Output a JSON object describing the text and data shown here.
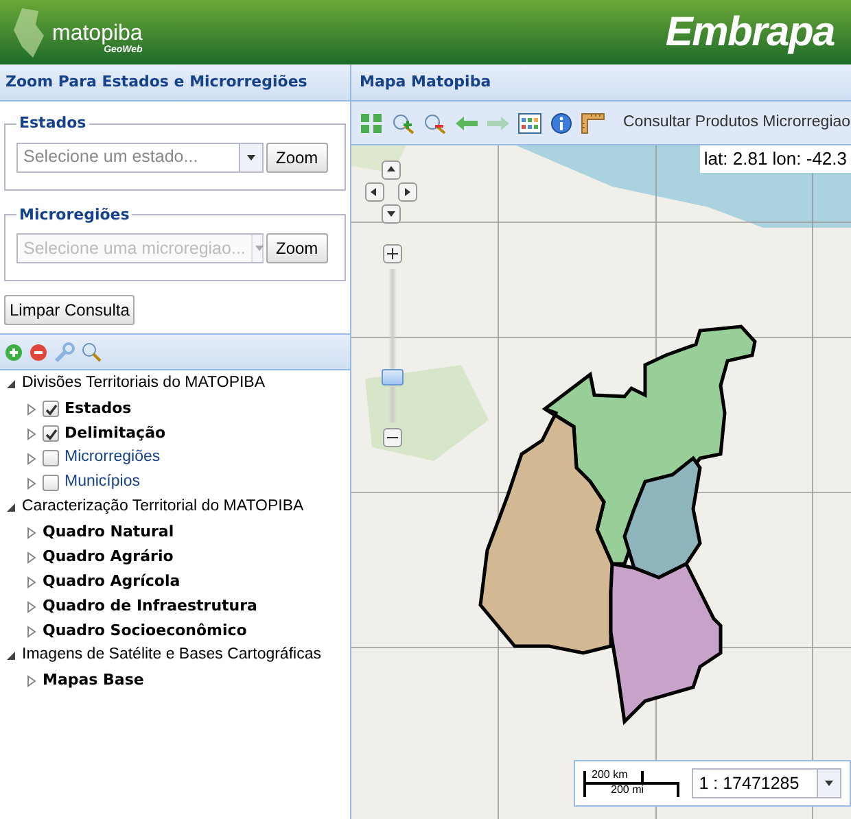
{
  "header": {
    "logo_text": "matopiba",
    "logo_subtext": "GeoWeb",
    "brand": "Embrapa"
  },
  "left_panel": {
    "title": "Zoom Para Estados e Microrregiões",
    "fieldsets": [
      {
        "legend": "Estados",
        "placeholder": "Selecione um estado...",
        "disabled": false,
        "button": "Zoom"
      },
      {
        "legend": "Microregiões",
        "placeholder": "Selecione uma microregiao...",
        "disabled": true,
        "button": "Zoom"
      }
    ],
    "clear_button": "Limpar Consulta"
  },
  "layer_tree": {
    "groups": [
      {
        "label": "Divisões Territoriais do MATOPIBA",
        "expanded": true,
        "children": [
          {
            "kind": "checkbox",
            "label": "Estados",
            "checked": true
          },
          {
            "kind": "checkbox",
            "label": "Delimitação",
            "checked": true
          },
          {
            "kind": "checkbox",
            "label": "Microrregiões",
            "checked": false
          },
          {
            "kind": "checkbox",
            "label": "Municípios",
            "checked": false
          }
        ]
      },
      {
        "label": "Caracterização Territorial do MATOPIBA",
        "expanded": true,
        "children": [
          {
            "kind": "folder",
            "label": "Quadro Natural"
          },
          {
            "kind": "folder",
            "label": "Quadro Agrário"
          },
          {
            "kind": "folder",
            "label": "Quadro Agrícola"
          },
          {
            "kind": "folder",
            "label": "Quadro de Infraestrutura"
          },
          {
            "kind": "folder",
            "label": "Quadro Socioeconômico"
          }
        ]
      },
      {
        "label": "Imagens de Satélite e Bases Cartográficas",
        "expanded": true,
        "children": [
          {
            "kind": "folder",
            "label": "Mapas Base"
          }
        ]
      }
    ]
  },
  "map_panel": {
    "title": "Mapa Matopiba",
    "tools": [
      {
        "kind": "zoom-extent",
        "disabled": false
      },
      {
        "kind": "zoom-in",
        "disabled": false
      },
      {
        "kind": "zoom-out",
        "disabled": false
      },
      {
        "kind": "back",
        "disabled": false
      },
      {
        "kind": "forward",
        "disabled": true
      },
      {
        "kind": "table",
        "disabled": false
      },
      {
        "kind": "info",
        "disabled": false
      },
      {
        "kind": "ruler",
        "disabled": false
      }
    ],
    "query_button": "Consultar Produtos Microrregiao",
    "coordinates": "lat: 2.81 lon: -42.3",
    "zoom_slider": {
      "level": 0.27
    },
    "scale_km": "200 km",
    "scale_mi": "200 mi",
    "scale_ratio": "1 : 17471285"
  }
}
